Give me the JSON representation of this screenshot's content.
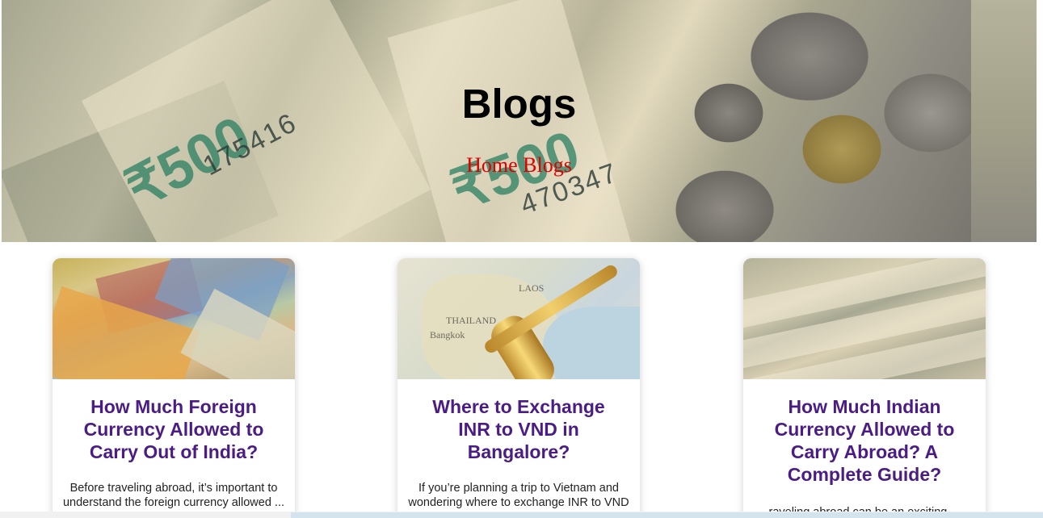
{
  "hero": {
    "title": "Blogs",
    "breadcrumb": [
      "Home",
      "Blogs"
    ]
  },
  "cards": [
    {
      "title": "How Much Foreign Currency Allowed to Carry Out of India?",
      "excerpt": "Before traveling abroad, it’s important to understand the foreign currency allowed ..."
    },
    {
      "title": "Where to Exchange INR to VND in Bangalore?",
      "excerpt": "If you’re planning a trip to Vietnam and wondering where to exchange INR to VND in Bangalore, you’re in the right place. Exchanging currency before your ..."
    },
    {
      "title": "How Much Indian Currency Allowed to Carry Abroad? A Complete Guide?",
      "excerpt": "raveling abroad can be an exciting ..."
    }
  ],
  "colors": {
    "title_accent": "#4b1c83",
    "breadcrumb": "#e00000"
  }
}
